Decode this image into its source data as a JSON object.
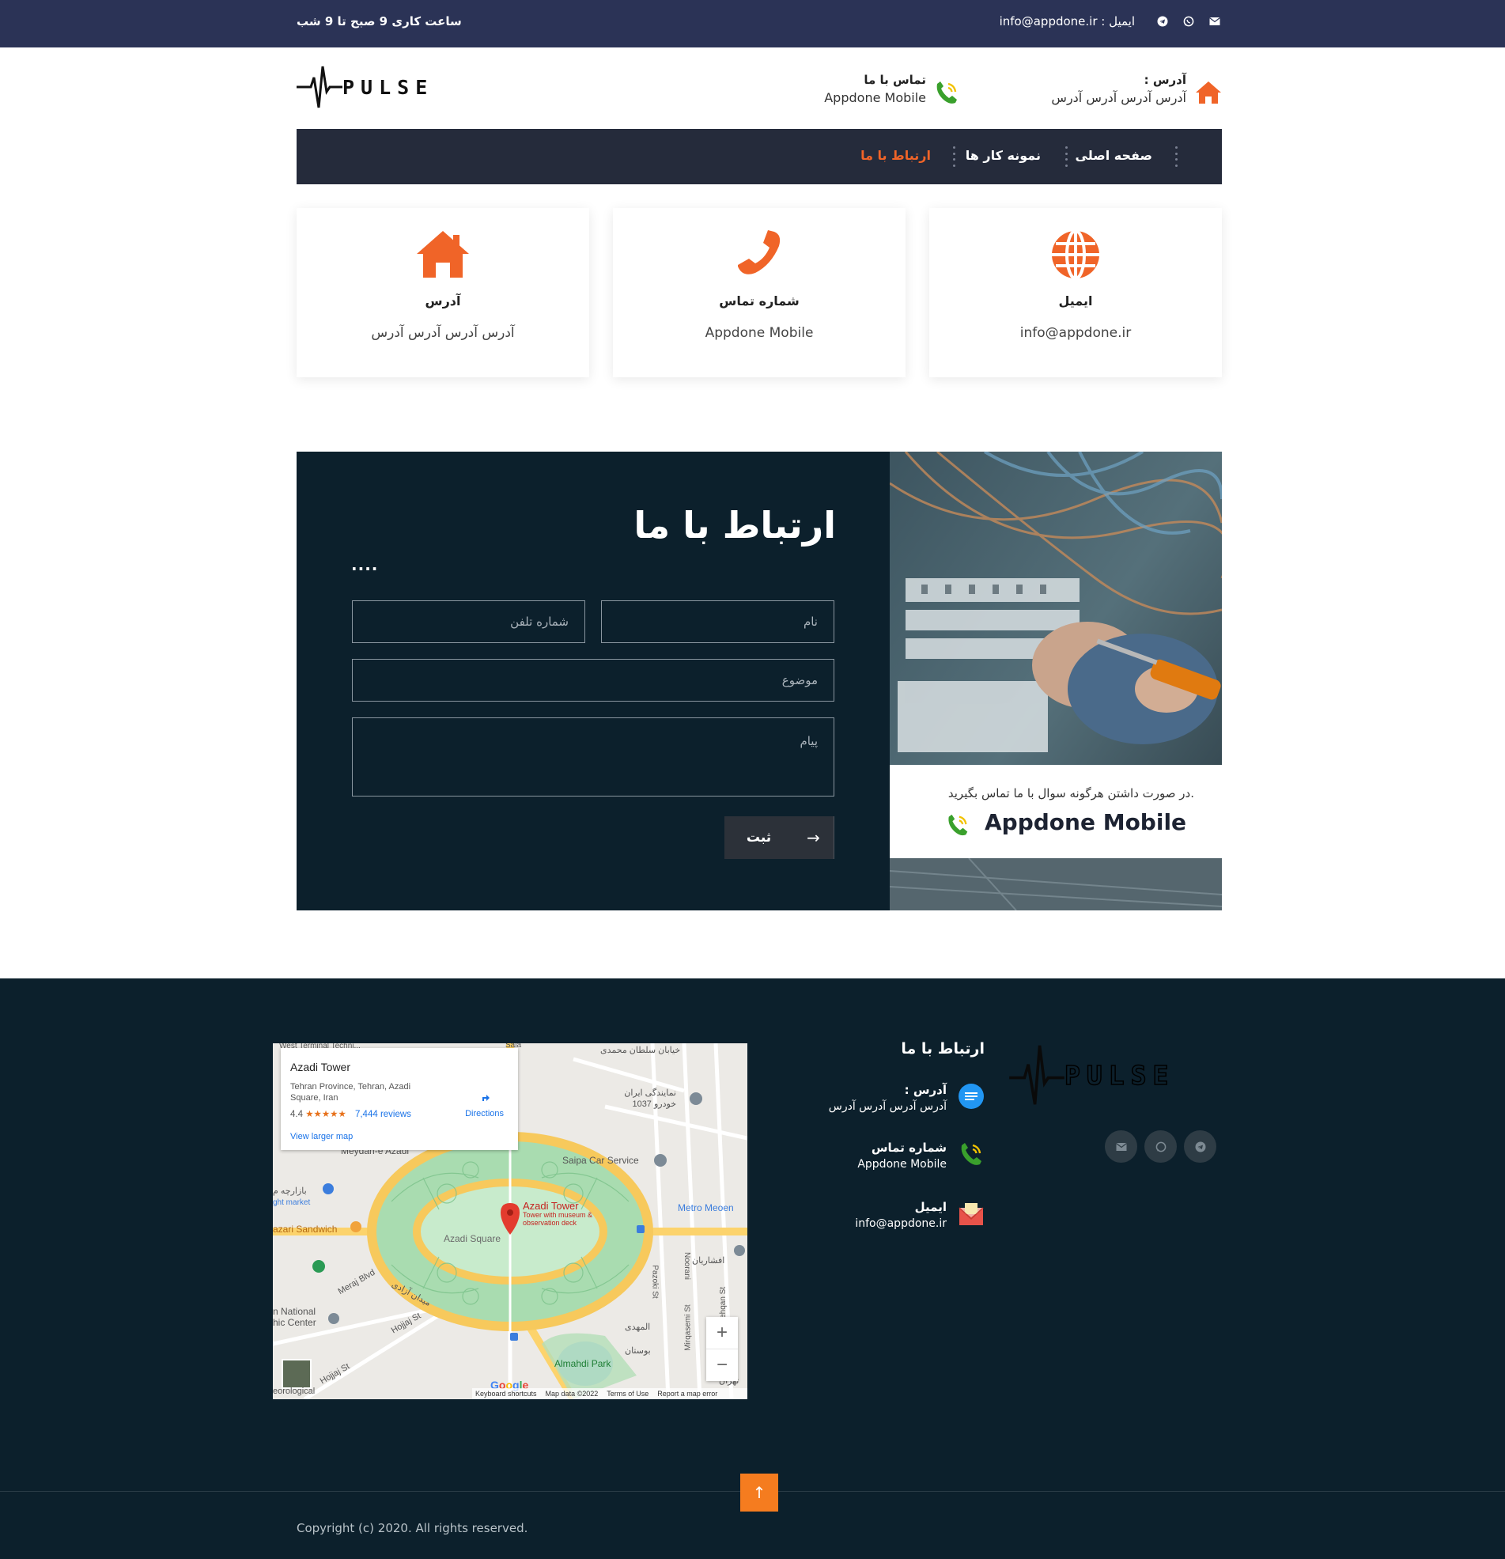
{
  "topbar": {
    "hours": "ساعت کاری 9 صبح تا 9 شب",
    "email": "ایمیل : info@appdone.ir",
    "icons": [
      "email-icon",
      "whatsapp-icon",
      "telegram-icon"
    ]
  },
  "header": {
    "logo_text": "PULSE",
    "address_title": "آدرس :",
    "address_value": "آدرس آدرس آدرس آدرس",
    "phone_title": "تماس با ما",
    "phone_value": "Appdone Mobile"
  },
  "nav": {
    "items": [
      "صفحه اصلی",
      "نمونه کار ها",
      "ارتباط با ما"
    ],
    "active_index": 2
  },
  "cards": [
    {
      "icon": "home-icon",
      "title": "آدرس",
      "value": "آدرس آدرس آدرس آدرس"
    },
    {
      "icon": "phone-icon",
      "title": "شماره تماس",
      "value": "Appdone Mobile"
    },
    {
      "icon": "globe-icon",
      "title": "ایمیل",
      "value": "info@appdone.ir"
    }
  ],
  "contact": {
    "heading": "ارتباط با ما",
    "dots": "....",
    "name_placeholder": "نام",
    "phone_placeholder": "شماره تلفن",
    "subject_placeholder": "موضوع",
    "message_placeholder": "پیام",
    "submit_label": "ثبت",
    "submit_arrow": "→",
    "callout_text": ".در صورت داشتن هرگونه سوال با ما تماس بگیرید",
    "callout_number": "Appdone Mobile"
  },
  "map": {
    "place_name": "Azadi Tower",
    "address": "Tehran Province, Tehran, Azadi Square, Iran",
    "rating": "4.4",
    "stars": "★★★★★",
    "reviews": "7,444 reviews",
    "larger_map": "View larger map",
    "directions": "Directions",
    "labels": {
      "meydan": "Meydan-e Azadi",
      "saipa": "Saipa Car Service",
      "metro": "Metro Meoen",
      "tower_title": "Azadi Tower",
      "tower_sub": "Tower with museum & observation deck",
      "square": "Azadi Square",
      "sandwich": "azari Sandwich",
      "meraj": "Meraj Blvd",
      "hojjaj": "Hojjaj St",
      "hojjaj2": "Hojjaj St",
      "national": "n National hic Center",
      "almahdi": "Almahdi Park",
      "noorani": "Noorani",
      "pazoki": "Pazoki St",
      "mirqasemi": "Mirqasemi St",
      "dehqan": "Dehqan St",
      "market": "ght market",
      "sala": "Sala",
      "west_terminal": "West Terminal Techni...",
      "khodro": "نمایندگی ایران خودرو 1037",
      "sultan": "خیابان سلطان محمدی",
      "ostad": "افشاریان",
      "azadi_fa": "میدان آزادی",
      "mahdi_fa": "المهدی",
      "bustan": "بوستان",
      "tehran_fa": "تهران",
      "hospital": "بازارچه م",
      "aero": "eorological"
    },
    "zoom_in": "+",
    "zoom_out": "−",
    "google": "Google",
    "footer": [
      "Keyboard shortcuts",
      "Map data ©2022",
      "Terms of Use",
      "Report a map error"
    ]
  },
  "footer": {
    "logo_text": "PULSE",
    "heading": "ارتباط با ما",
    "address_title": "آدرس :",
    "address_value": "آدرس آدرس آدرس آدرس",
    "phone_title": "شماره تماس",
    "phone_value": "Appdone Mobile",
    "email_title": "ایمیل",
    "email_value": "info@appdone.ir",
    "social": [
      "email-icon",
      "whatsapp-icon",
      "telegram-icon"
    ],
    "totop": "↑",
    "copyright": "Copyright (c) 2020. All rights reserved."
  },
  "colors": {
    "topbar": "#2b3356",
    "nav": "#252b3b",
    "accent": "#f06428",
    "dark": "#0c202c",
    "totop": "#f57c1f"
  }
}
